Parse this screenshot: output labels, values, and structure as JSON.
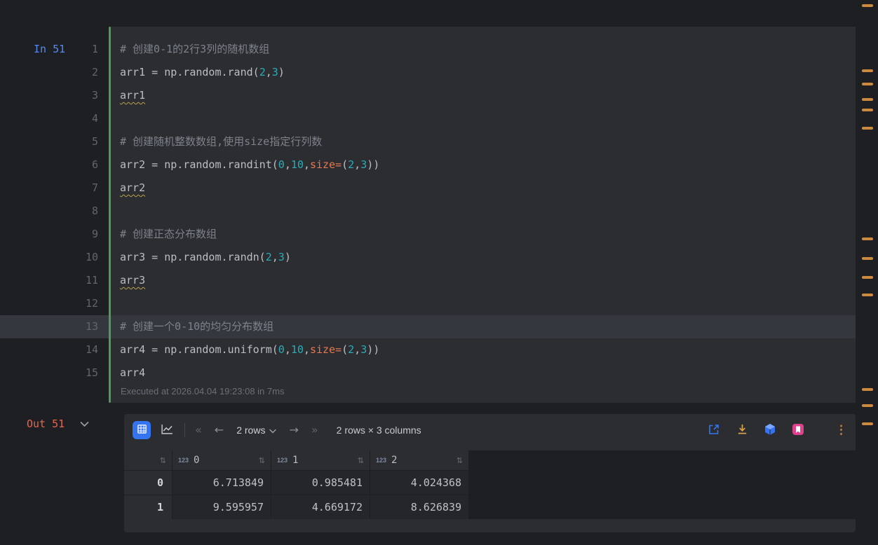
{
  "editor": {
    "in_label": "In 51",
    "executed_text": "Executed at 2026.04.04 19:23:08 in 7ms",
    "lines": [
      {
        "num": 1,
        "tokens": [
          {
            "s": "comment",
            "t": "# 创建0-1的2行3列的随机数组"
          }
        ]
      },
      {
        "num": 2,
        "tokens": [
          {
            "s": "plain",
            "t": "arr1 = np.random.rand("
          },
          {
            "s": "number",
            "t": "2"
          },
          {
            "s": "plain",
            "t": ","
          },
          {
            "s": "number",
            "t": "3"
          },
          {
            "s": "plain",
            "t": ")"
          }
        ]
      },
      {
        "num": 3,
        "tokens": [
          {
            "s": "warn",
            "t": "arr1"
          }
        ]
      },
      {
        "num": 4,
        "tokens": []
      },
      {
        "num": 5,
        "tokens": [
          {
            "s": "comment",
            "t": "# 创建随机整数数组,使用size指定行列数"
          }
        ]
      },
      {
        "num": 6,
        "tokens": [
          {
            "s": "plain",
            "t": "arr2 = np.random.randint("
          },
          {
            "s": "number",
            "t": "0"
          },
          {
            "s": "plain",
            "t": ","
          },
          {
            "s": "number",
            "t": "10"
          },
          {
            "s": "plain",
            "t": ","
          },
          {
            "s": "param",
            "t": "size="
          },
          {
            "s": "plain",
            "t": "("
          },
          {
            "s": "number",
            "t": "2"
          },
          {
            "s": "plain",
            "t": ","
          },
          {
            "s": "number",
            "t": "3"
          },
          {
            "s": "plain",
            "t": "))"
          }
        ]
      },
      {
        "num": 7,
        "tokens": [
          {
            "s": "warn",
            "t": "arr2"
          }
        ]
      },
      {
        "num": 8,
        "tokens": []
      },
      {
        "num": 9,
        "tokens": [
          {
            "s": "comment",
            "t": "# 创建正态分布数组"
          }
        ]
      },
      {
        "num": 10,
        "tokens": [
          {
            "s": "plain",
            "t": "arr3 = np.random.randn("
          },
          {
            "s": "number",
            "t": "2"
          },
          {
            "s": "plain",
            "t": ","
          },
          {
            "s": "number",
            "t": "3"
          },
          {
            "s": "plain",
            "t": ")"
          }
        ]
      },
      {
        "num": 11,
        "tokens": [
          {
            "s": "warn",
            "t": "arr3"
          }
        ]
      },
      {
        "num": 12,
        "tokens": []
      },
      {
        "num": 13,
        "highlight": true,
        "tokens": [
          {
            "s": "comment",
            "t": "# 创建一个0-10的均匀分布数组"
          }
        ]
      },
      {
        "num": 14,
        "tokens": [
          {
            "s": "plain",
            "t": "arr4 = np.random.uniform("
          },
          {
            "s": "number",
            "t": "0"
          },
          {
            "s": "plain",
            "t": ","
          },
          {
            "s": "number",
            "t": "10"
          },
          {
            "s": "plain",
            "t": ","
          },
          {
            "s": "param",
            "t": "size="
          },
          {
            "s": "plain",
            "t": "("
          },
          {
            "s": "number",
            "t": "2"
          },
          {
            "s": "plain",
            "t": ","
          },
          {
            "s": "number",
            "t": "3"
          },
          {
            "s": "plain",
            "t": "))"
          }
        ]
      },
      {
        "num": 15,
        "tokens": [
          {
            "s": "plain",
            "t": "arr4"
          }
        ]
      }
    ]
  },
  "output": {
    "out_label": "Out 51",
    "toolbar": {
      "page_size": "2 rows",
      "dimensions": "2 rows × 3 columns"
    }
  },
  "table": {
    "type_badge": "123",
    "columns": [
      "0",
      "1",
      "2"
    ],
    "rows": [
      {
        "index": "0",
        "values": [
          "6.713849",
          "0.985481",
          "4.024368"
        ]
      },
      {
        "index": "1",
        "values": [
          "9.595957",
          "4.669172",
          "8.626839"
        ]
      }
    ]
  },
  "icons": {
    "sort": "⇅",
    "first_page": "«",
    "prev_page": "←",
    "next_page": "→",
    "last_page": "»",
    "menu": "⋮"
  },
  "colors": {
    "accent_blue": "#3574f0",
    "in_label": "#548af7",
    "out_label": "#e5674f",
    "execution_bar": "#4e9b57",
    "warning_mark": "#cc8a3e"
  },
  "scrollbar": {
    "marks": [
      6,
      99,
      118,
      140,
      155,
      181,
      339,
      367,
      394,
      419,
      554,
      577,
      603
    ]
  }
}
